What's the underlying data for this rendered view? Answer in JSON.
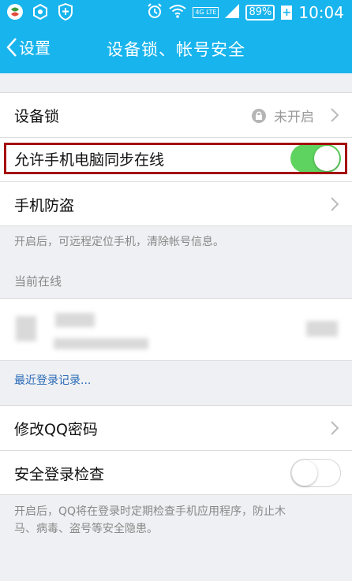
{
  "status_bar": {
    "network": "4G LTE",
    "battery": "89%",
    "time": "10:04",
    "icons": [
      "app-icon",
      "hexagon-icon",
      "shield-plus-icon",
      "alarm-icon",
      "wifi-icon",
      "signal-icon",
      "battery-icon",
      "charging-plus-icon"
    ]
  },
  "nav": {
    "back_label": "设置",
    "title": "设备锁、帐号安全"
  },
  "device_lock": {
    "label": "设备锁",
    "status": "未开启"
  },
  "sync_online": {
    "label": "允许手机电脑同步在线",
    "enabled": true
  },
  "anti_theft": {
    "label": "手机防盗",
    "hint": "开启后，可远程定位手机，清除帐号信息。"
  },
  "online": {
    "section_title": "当前在线"
  },
  "recent_login": {
    "link": "最近登录记录..."
  },
  "change_password": {
    "label": "修改QQ密码"
  },
  "secure_login": {
    "label": "安全登录检查",
    "enabled": false,
    "hint_line1": "开启后，QQ将在登录时定期检查手机应用程序，防止木",
    "hint_line2": "马、病毒、盗号等安全隐患。"
  },
  "colors": {
    "accent": "#18b4ed",
    "toggle_on": "#5fd35f",
    "link": "#2a6ab7",
    "highlight": "#a40d0d"
  }
}
